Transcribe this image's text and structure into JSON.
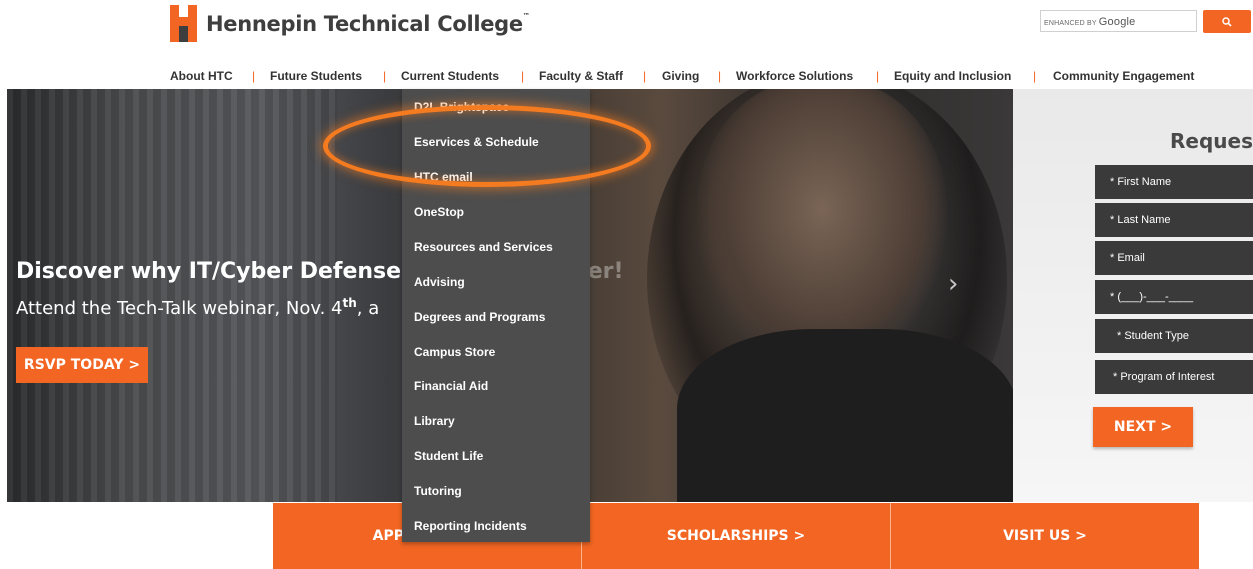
{
  "header": {
    "logo_text": "Hennepin Technical College",
    "logo_tm": "™",
    "search_label_prefix": "ENHANCED BY",
    "search_label_brand": "Google",
    "search_icon": "search-icon",
    "brand_color": "#f26522"
  },
  "nav": {
    "items": [
      "About HTC",
      "Future Students",
      "Current Students",
      "Faculty & Staff",
      "Giving",
      "Workforce Solutions",
      "Equity and Inclusion",
      "Community Engagement"
    ],
    "separator": "|"
  },
  "hero": {
    "title_visible": "Discover why IT/Cyber Defense is",
    "title_dim": " a great career!",
    "subtitle_pre": "Attend the Tech-Talk webinar, Nov. 4",
    "subtitle_sup": "th",
    "subtitle_post": ", a",
    "button": "RSVP TODAY >",
    "next_arrow": "›"
  },
  "dropdown": {
    "items": [
      "D2L Brightspace",
      "Eservices & Schedule",
      "HTC email",
      "OneStop",
      "Resources and Services",
      "Advising",
      "Degrees and Programs",
      "Campus Store",
      "Financial Aid",
      "Library",
      "Student Life",
      "Tutoring",
      "Reporting Incidents"
    ],
    "highlighted": "Eservices & Schedule"
  },
  "form": {
    "title": "Request",
    "fields": [
      "* First Name",
      "* Last Name",
      "* Email",
      "* (___)-___-____",
      "* Student Type",
      "* Program of Interest"
    ],
    "next": "NEXT >"
  },
  "cta": {
    "items": [
      "APPLY NOW >",
      "SCHOLARSHIPS >",
      "VISIT US >"
    ]
  }
}
